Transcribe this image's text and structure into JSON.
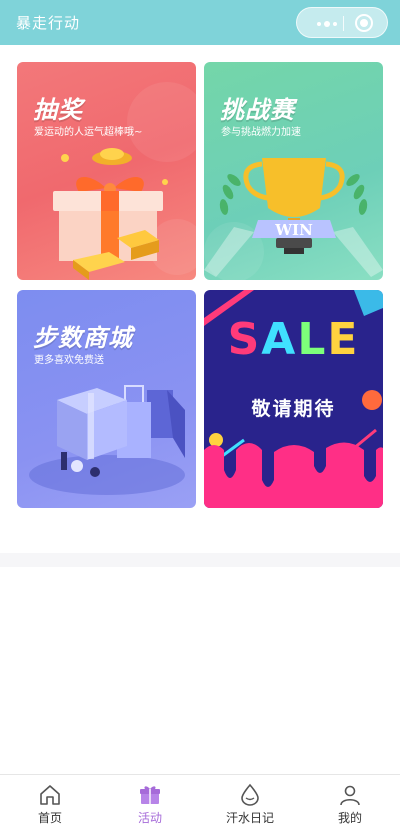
{
  "header": {
    "title": "暴走行动"
  },
  "capsule": {
    "more_icon": "more-dots-icon",
    "close_icon": "target-close-icon"
  },
  "cards": [
    {
      "title": "抽奖",
      "subtitle": "爱运动的人运气超棒哦~",
      "theme": "#f0696e"
    },
    {
      "title": "挑战赛",
      "subtitle": "参与挑战燃力加速",
      "badge": "WIN",
      "theme": "#6dcfb8"
    },
    {
      "title": "步数商城",
      "subtitle": "更多喜欢免费送",
      "theme": "#8a92f2"
    },
    {
      "title": "SALE",
      "subtitle": "敬请期待",
      "theme": "#29238c"
    }
  ],
  "tabbar": {
    "items": [
      {
        "label": "首页",
        "icon": "home-icon"
      },
      {
        "label": "活动",
        "icon": "gift-icon",
        "active": true
      },
      {
        "label": "汗水日记",
        "icon": "water-drop-icon"
      },
      {
        "label": "我的",
        "icon": "user-icon"
      }
    ],
    "active_color": "#a66bd9"
  }
}
